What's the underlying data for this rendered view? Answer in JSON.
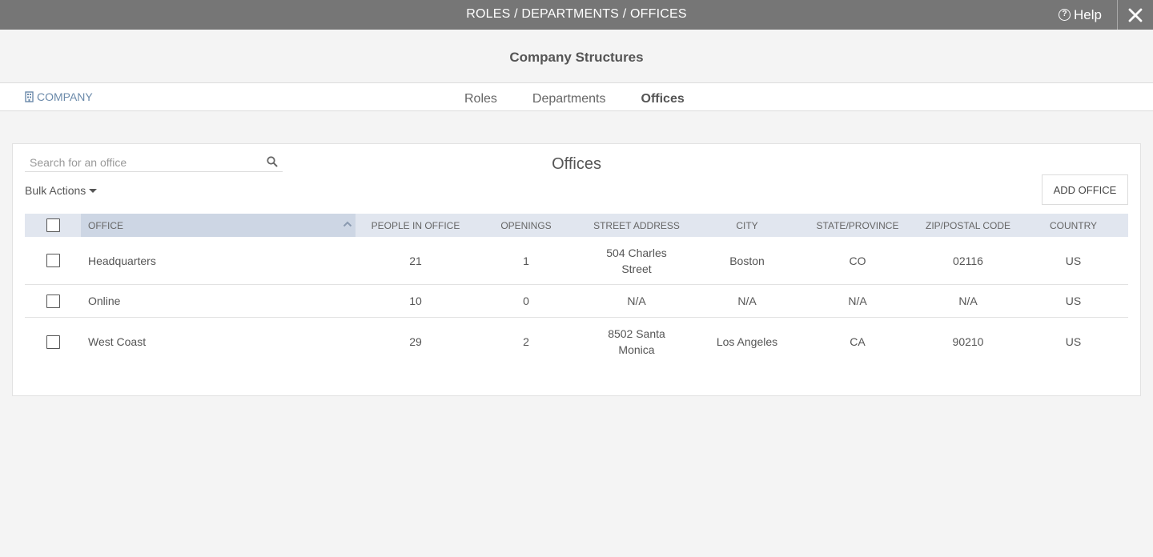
{
  "topbar": {
    "title": "ROLES / DEPARTMENTS / OFFICES",
    "help_label": "Help",
    "help_icon": "question-circle-icon",
    "close_icon": "close-icon"
  },
  "header": {
    "title": "Company Structures"
  },
  "nav": {
    "company_label": "COMPANY",
    "company_icon": "building-icon",
    "tabs": [
      {
        "label": "Roles",
        "active": false
      },
      {
        "label": "Departments",
        "active": false
      },
      {
        "label": "Offices",
        "active": true
      }
    ]
  },
  "card": {
    "title": "Offices",
    "search_placeholder": "Search for an office",
    "bulk_actions_label": "Bulk Actions",
    "add_button_label": "ADD OFFICE"
  },
  "table": {
    "columns": [
      "OFFICE",
      "PEOPLE IN OFFICE",
      "OPENINGS",
      "STREET ADDRESS",
      "CITY",
      "STATE/PROVINCE",
      "ZIP/POSTAL CODE",
      "COUNTRY"
    ],
    "rows": [
      {
        "office": "Headquarters",
        "people": "21",
        "openings": "1",
        "street": "504 Charles Street",
        "city": "Boston",
        "state": "CO",
        "zip": "02116",
        "country": "US"
      },
      {
        "office": "Online",
        "people": "10",
        "openings": "0",
        "street": "N/A",
        "city": "N/A",
        "state": "N/A",
        "zip": "N/A",
        "country": "US"
      },
      {
        "office": "West Coast",
        "people": "29",
        "openings": "2",
        "street": "8502 Santa Monica",
        "city": "Los Angeles",
        "state": "CA",
        "zip": "90210",
        "country": "US"
      }
    ]
  },
  "colors": {
    "topbar_bg": "#767676",
    "table_header_bg": "#e1e6ef",
    "sorted_header_bg": "#cdd6e4",
    "company_link": "#6b8aaa"
  }
}
